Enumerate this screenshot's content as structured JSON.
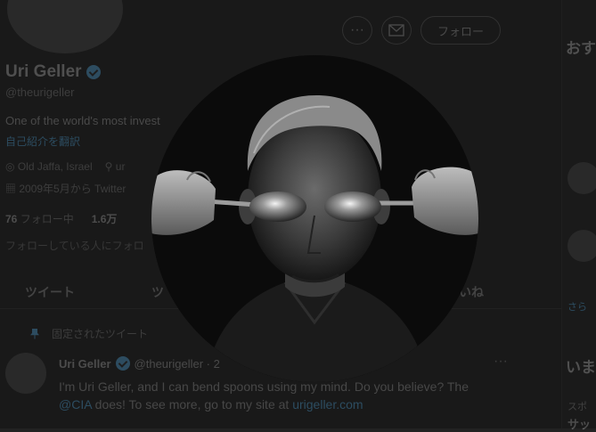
{
  "header": {
    "more_icon": "ellipsis-icon",
    "mail_icon": "mail-icon",
    "follow_label": "フォロー"
  },
  "profile": {
    "name": "Uri Geller",
    "handle": "@theurigeller",
    "bio": "One of the world's most invest",
    "bio_link": "自己紹介を翻訳",
    "location": "Old Jaffa, Israel",
    "website_prefix": "ur",
    "joined": "2009年5月から Twitter",
    "following_count": "76",
    "following_label": "フォロー中",
    "followers_count": "1.6万",
    "followed_by": "フォローしている人にフォロ"
  },
  "tabs": [
    "ツイート",
    "ツ",
    "いね"
  ],
  "pinned_label": "固定されたツイート",
  "tweet": {
    "author": "Uri Geller",
    "handle": "@theurigeller · 2",
    "line1": "I'm Uri Geller, and I can bend spoons using my mind. Do you believe? The",
    "mention": "@CIA",
    "line2_mid": " does! To see more, go to my site at ",
    "link": "urigeller.com"
  },
  "right": {
    "heading1": "おす",
    "heading2": "いま",
    "mini1": "スポ",
    "mini2": "サッ",
    "more": "さら"
  },
  "photo": {
    "description_icon": "profile-photo-enlarged"
  },
  "colors": {
    "background": "#232323",
    "accent": "#3f6a86"
  }
}
